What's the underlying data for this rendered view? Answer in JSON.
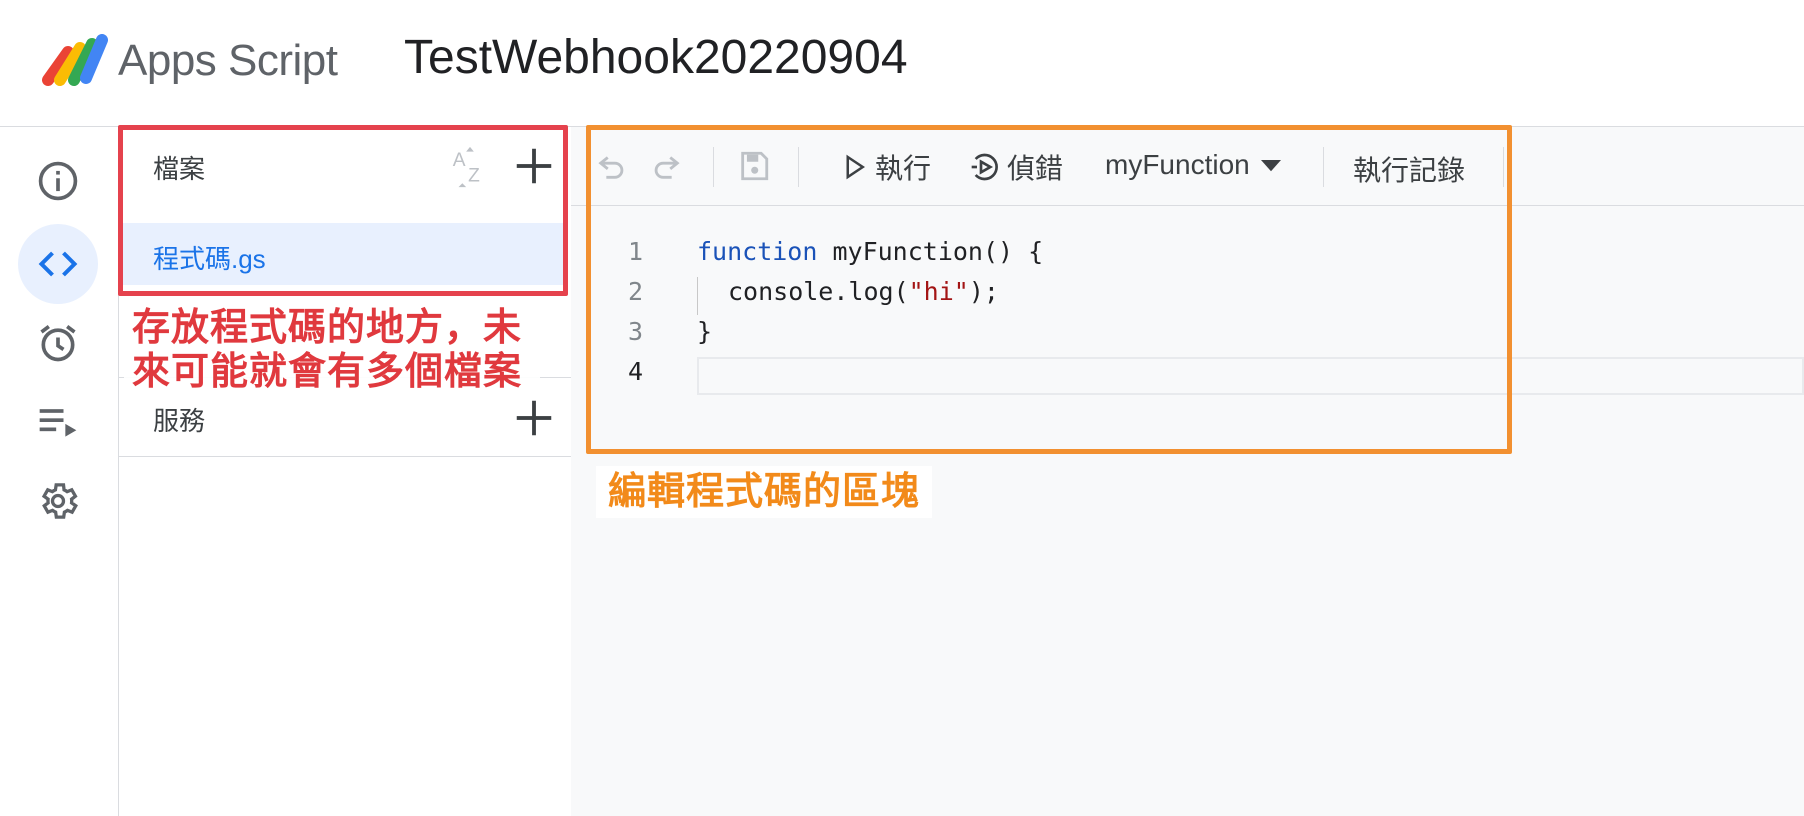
{
  "header": {
    "app_name": "Apps Script",
    "project_title": "TestWebhook20220904"
  },
  "rail": {
    "items": [
      {
        "name": "overview",
        "icon": "info-icon"
      },
      {
        "name": "editor",
        "icon": "code-icon",
        "active": true
      },
      {
        "name": "triggers",
        "icon": "alarm-icon"
      },
      {
        "name": "executions",
        "icon": "playlist-icon"
      },
      {
        "name": "settings",
        "icon": "gear-icon"
      }
    ]
  },
  "files": {
    "title": "檔案",
    "sort_icon": "sort-az-icon",
    "add_icon": "plus-icon",
    "items": [
      {
        "name": "程式碼.gs",
        "selected": true
      }
    ]
  },
  "services": {
    "title": "服務",
    "add_icon": "plus-icon"
  },
  "toolbar": {
    "undo_icon": "undo-icon",
    "redo_icon": "redo-icon",
    "save_icon": "save-icon",
    "run_label": "執行",
    "debug_label": "偵錯",
    "function_select": "myFunction",
    "log_label": "執行記錄"
  },
  "editor": {
    "lines": [
      {
        "number": "1"
      },
      {
        "number": "2"
      },
      {
        "number": "3"
      },
      {
        "number": "4"
      }
    ],
    "code": {
      "l1_kw": "function",
      "l1_rest": " myFunction() {",
      "l2_a": "console.log(",
      "l2_str": "\"hi\"",
      "l2_b": ");",
      "l3": "}",
      "l4": ""
    }
  },
  "annotations": {
    "files_note_line1": "存放程式碼的地方，未",
    "files_note_line2": "來可能就會有多個檔案",
    "editor_note": "編輯程式碼的區塊",
    "colors": {
      "files_box": "#e5424d",
      "editor_box": "#f29030"
    }
  }
}
